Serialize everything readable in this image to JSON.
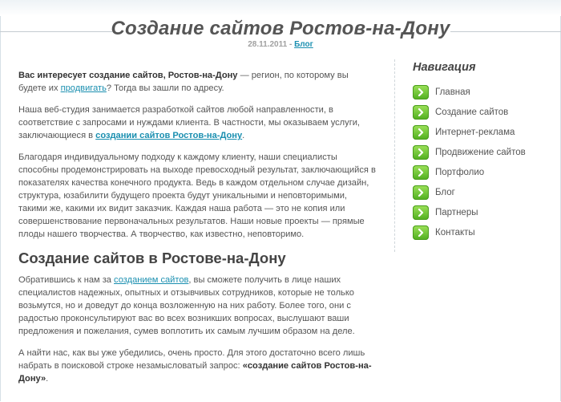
{
  "header": {
    "title": "Создание сайтов Ростов-на-Дону",
    "date": "28.11.2011",
    "separator": " - ",
    "category": "Блог"
  },
  "content": {
    "p1": {
      "bold": "Вас интересует создание сайтов, Ростов-на-Дону",
      "text1": " — регион, по которому вы будете их ",
      "link": "продвигать",
      "text2": "? Тогда вы зашли по адресу."
    },
    "p2": {
      "text1": "Наша веб-студия занимается разработкой сайтов любой направленности, в соответствие с запросами и нуждами клиента. В частности, мы оказываем услуги, заключающиеся в ",
      "link": "создании сайтов Ростов-на-Дону",
      "text2": "."
    },
    "p3": "Благодаря индивидуальному подходу к каждому клиенту, наши специалисты способны продемонстрировать на выходе превосходный результат, заключающийся в показателях качества конечного продукта. Ведь в каждом отдельном случае дизайн, структура, юзабилити будущего проекта будут уникальными и неповторимыми, такими же, какими их видит заказчик. Каждая наша работа — это не копия или совершенствование первоначальных результатов. Наши новые проекты — прямые плоды нашего творчества. А творчество, как известно, неповторимо.",
    "heading": "Создание сайтов в Ростове-на-Дону",
    "p4": {
      "text1": "Обратившись к нам за ",
      "link": "созданием сайтов",
      "text2": ", вы сможете получить в лице наших специалистов надежных, опытных и отзывчивых сотрудников, которые не только возьмутся, но и доведут до конца возложенную на них работу. Более того, они с радостью проконсультируют вас во всех возникших вопросах, выслушают ваши предложения и пожелания, сумев воплотить их самым лучшим образом на деле."
    },
    "p5": {
      "text1": "А найти нас, как вы уже убедились, очень просто. Для этого достаточно всего лишь набрать в поисковой строке незамысловатый запрос: ",
      "bold": "«создание сайтов Ростов-на-Дону»",
      "text2": "."
    }
  },
  "sidebar": {
    "title": "Навигация",
    "icon": "arrow-right-icon",
    "icon_color": "#5cbf23",
    "items": [
      {
        "label": "Главная"
      },
      {
        "label": "Создание сайтов"
      },
      {
        "label": "Интернет-реклама"
      },
      {
        "label": "Продвижение сайтов"
      },
      {
        "label": "Портфолио"
      },
      {
        "label": "Блог"
      },
      {
        "label": "Партнеры"
      },
      {
        "label": "Контакты"
      }
    ]
  },
  "colors": {
    "link": "#1a8fb0",
    "title": "#555555",
    "text": "#555555"
  }
}
